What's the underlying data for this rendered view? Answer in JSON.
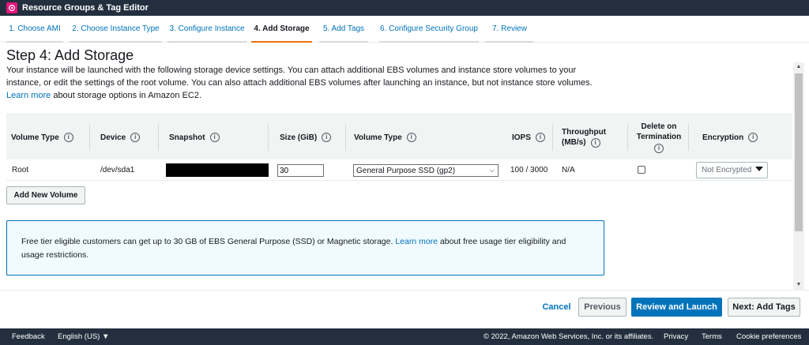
{
  "app": {
    "title": "Resource Groups & Tag Editor",
    "icon": "resource-groups-icon",
    "brand_color": "#e7157b"
  },
  "steps": [
    {
      "label": "1. Choose AMI",
      "active": false
    },
    {
      "label": "2. Choose Instance Type",
      "active": false
    },
    {
      "label": "3. Configure Instance",
      "active": false
    },
    {
      "label": "4. Add Storage",
      "active": true
    },
    {
      "label": "5. Add Tags",
      "active": false
    },
    {
      "label": "6. Configure Security Group",
      "active": false
    },
    {
      "label": "7. Review",
      "active": false
    }
  ],
  "page": {
    "title": "Step 4: Add Storage",
    "desc_before": "Your instance will be launched with the following storage device settings. You can attach additional EBS volumes and instance store volumes to your instance, or edit the settings of the root volume. You can also attach additional EBS volumes after launching an instance, but not instance store volumes. ",
    "desc_link": "Learn more",
    "desc_after": " about storage options in Amazon EC2."
  },
  "table": {
    "headers": {
      "volume_type": "Volume Type",
      "device": "Device",
      "snapshot": "Snapshot",
      "size": "Size (GiB)",
      "vol_type": "Volume Type",
      "iops": "IOPS",
      "throughput_1": "Throughput",
      "throughput_2": "(MB/s)",
      "delete_1": "Delete on",
      "delete_2": "Termination",
      "encryption": "Encryption",
      "info": "i"
    },
    "row": {
      "volume_type": "Root",
      "device": "/dev/sda1",
      "size": "30",
      "vol_type": "General Purpose SSD (gp2)",
      "iops": "100 / 3000",
      "throughput": "N/A",
      "delete_on_termination": false,
      "encryption": "Not Encrypted"
    }
  },
  "add_volume": "Add New Volume",
  "info_box": {
    "text_before": "Free tier eligible customers can get up to 30 GB of EBS General Purpose (SSD) or Magnetic storage. ",
    "link": "Learn more",
    "text_after": " about free usage tier eligibility and usage restrictions."
  },
  "actions": {
    "cancel": "Cancel",
    "previous": "Previous",
    "review_launch": "Review and Launch",
    "next": "Next: Add Tags"
  },
  "footer": {
    "feedback": "Feedback",
    "language": "English (US) ▼",
    "copyright": "© 2022, Amazon Web Services, Inc. or its affiliates.",
    "privacy": "Privacy",
    "terms": "Terms",
    "cookies": "Cookie preferences"
  },
  "colors": {
    "link": "#0073bb",
    "primary": "#0073bb",
    "active_tab": "#ec7211",
    "nav_bg": "#232f3e"
  }
}
